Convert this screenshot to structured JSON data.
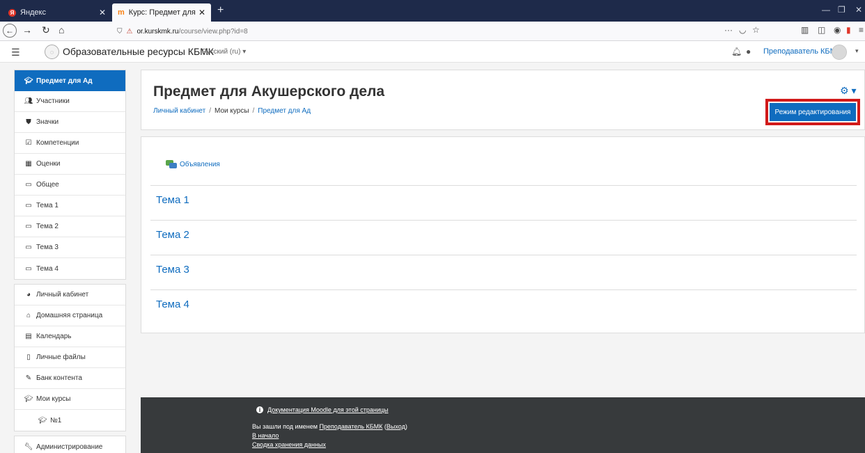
{
  "browser": {
    "tabs": [
      {
        "label": "Яндекс",
        "favicon": "yandex-icon"
      },
      {
        "label": "Курс: Предмет для Акушерск",
        "favicon": "moodle-icon"
      }
    ],
    "new_tab": "+",
    "url_host": "or.kurskmk.ru",
    "url_path": "/course/view.php?id=8",
    "url_prefix": ""
  },
  "header": {
    "site_name": "Образовательные ресурсы КБМК",
    "language": "Русский (ru) ▾",
    "user_name": "Преподаватель КБМК",
    "user_caret": "▾"
  },
  "sidebar": {
    "group1": [
      {
        "label": "Предмет для Ад",
        "icon": "graduation-cap-icon"
      },
      {
        "label": "Участники",
        "icon": "users-icon"
      },
      {
        "label": "Значки",
        "icon": "shield-icon"
      },
      {
        "label": "Компетенции",
        "icon": "check-square-icon"
      },
      {
        "label": "Оценки",
        "icon": "table-icon"
      },
      {
        "label": "Общее",
        "icon": "folder-icon"
      },
      {
        "label": "Тема 1",
        "icon": "folder-icon"
      },
      {
        "label": "Тема 2",
        "icon": "folder-icon"
      },
      {
        "label": "Тема 3",
        "icon": "folder-icon"
      },
      {
        "label": "Тема 4",
        "icon": "folder-icon"
      }
    ],
    "group2": [
      {
        "label": "Личный кабинет",
        "icon": "dashboard-icon"
      },
      {
        "label": "Домашняя страница",
        "icon": "home-icon"
      },
      {
        "label": "Календарь",
        "icon": "calendar-icon"
      },
      {
        "label": "Личные файлы",
        "icon": "file-icon"
      },
      {
        "label": "Банк контента",
        "icon": "brush-icon"
      },
      {
        "label": "Мои курсы",
        "icon": "graduation-cap-icon"
      },
      {
        "label": "№1",
        "icon": "graduation-cap-icon"
      }
    ],
    "group3": [
      {
        "label": "Администрирование",
        "icon": "wrench-icon"
      }
    ]
  },
  "course": {
    "title": "Предмет для Акушерского дела",
    "breadcrumb": [
      "Личный кабинет",
      "Мои курсы",
      "Предмет для Ад"
    ],
    "edit_button": "Режим редактирования",
    "gear_label": "⚙ ▾",
    "activity": "Объявления",
    "sections": [
      "Тема 1",
      "Тема 2",
      "Тема 3",
      "Тема 4"
    ]
  },
  "footer": {
    "doc_link": "Документация Moodle для этой страницы",
    "login_prefix": "Вы зашли под именем",
    "login_user": "Преподаватель КБМК",
    "logout": "Выход",
    "home": "В начало",
    "data_summary": "Сводка хранения данных"
  },
  "colors": {
    "brand": "#0f6cbf",
    "highlight_box": "#d11a1a",
    "footer_bg": "#373a3c",
    "tabstrip_bg": "#1e2a4a"
  }
}
